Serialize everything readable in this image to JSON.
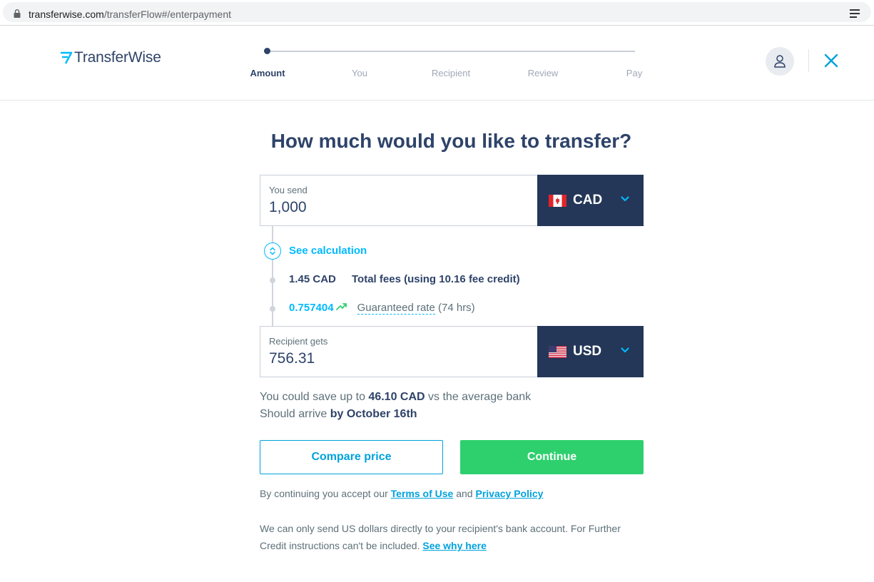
{
  "browser": {
    "url_host": "transferwise.com",
    "url_path": "/transferFlow#/enterpayment"
  },
  "header": {
    "logo_text": "TransferWise",
    "steps": [
      "Amount",
      "You",
      "Recipient",
      "Review",
      "Pay"
    ],
    "active_step": "Amount"
  },
  "main": {
    "title": "How much would you like to transfer?",
    "send": {
      "label": "You send",
      "value": "1,000",
      "currency": "CAD"
    },
    "calculation": {
      "toggle_label": "See calculation",
      "fee_amount": "1.45 CAD",
      "fee_label": "Total fees (using 10.16 fee credit)",
      "rate": "0.757404",
      "rate_label": "Guaranteed rate",
      "rate_duration": "(74 hrs)"
    },
    "receive": {
      "label": "Recipient gets",
      "value": "756.31",
      "currency": "USD"
    },
    "savings_prefix": "You could save up to",
    "savings_amount": "46.10 CAD",
    "savings_suffix": "vs the average bank",
    "arrive_prefix": "Should arrive",
    "arrive_date": "by October 16th",
    "compare_label": "Compare price",
    "continue_label": "Continue",
    "legal_prefix": "By continuing you accept our",
    "terms_label": "Terms of Use",
    "legal_and": "and",
    "privacy_label": "Privacy Policy",
    "note_text": "We can only send US dollars directly to your recipient's bank account. For Further Credit instructions can't be included.",
    "note_link": "See why here"
  },
  "colors": {
    "navy": "#2e4369",
    "currency_bg": "#243758",
    "accent_blue": "#00b9ff",
    "green": "#2ed06e"
  }
}
